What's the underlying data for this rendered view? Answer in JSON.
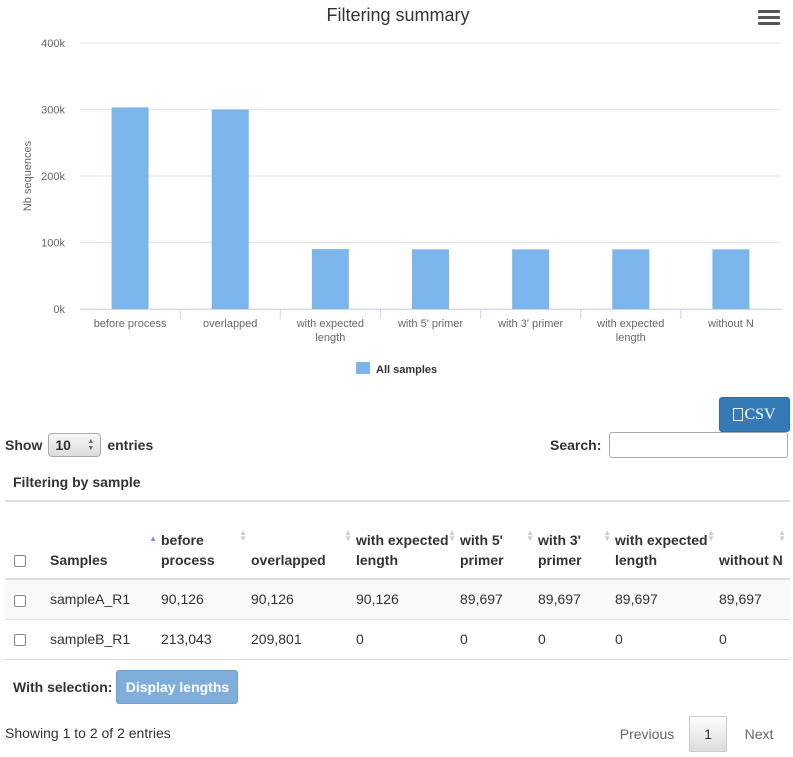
{
  "chart": {
    "menu_icon": "hamburger-icon",
    "bar_color": "#7cb5ec"
  },
  "chart_data": {
    "type": "bar",
    "title": "Filtering summary",
    "ylabel": "Nb sequences",
    "xlabel": "",
    "ylim": [
      0,
      400000
    ],
    "yticks": [
      "0k",
      "100k",
      "200k",
      "300k",
      "400k"
    ],
    "categories": [
      "before process",
      "overlapped",
      "with expected length",
      "with 5' primer",
      "with 3' primer",
      "with expected length",
      "without N"
    ],
    "series": [
      {
        "name": "All samples",
        "values": [
          303169,
          299927,
          90126,
          89697,
          89697,
          89697,
          89697
        ]
      }
    ],
    "legend_position": "bottom-center",
    "grid": true
  },
  "toolbar": {
    "csv_label": "CSV",
    "csv_icon": "file-icon"
  },
  "length_control": {
    "show_label": "Show",
    "value": "10",
    "entries_label": "entries"
  },
  "search": {
    "label": "Search:",
    "value": ""
  },
  "table": {
    "title": "Filtering by sample",
    "headers": [
      "Samples",
      "before process",
      "overlapped",
      "with expected length",
      "with 5' primer",
      "with 3' primer",
      "with expected length",
      "without N"
    ],
    "rows": [
      [
        "sampleA_R1",
        "90,126",
        "90,126",
        "90,126",
        "89,697",
        "89,697",
        "89,697",
        "89,697"
      ],
      [
        "sampleB_R1",
        "213,043",
        "209,801",
        "0",
        "0",
        "0",
        "0",
        "0"
      ]
    ]
  },
  "selection": {
    "label": "With selection:",
    "button_label": "Display lengths"
  },
  "footer": {
    "info": "Showing 1 to 2 of 2 entries",
    "prev": "Previous",
    "page": "1",
    "next": "Next"
  }
}
